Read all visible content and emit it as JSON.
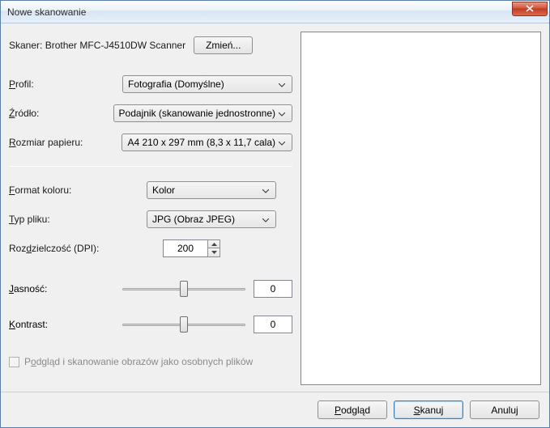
{
  "window": {
    "title": "Nowe skanowanie"
  },
  "scanner": {
    "label": "Skaner: Brother MFC-J4510DW Scanner",
    "change_btn": "Zmień..."
  },
  "profile": {
    "label": "Profil:",
    "value": "Fotografia (Domyślne)"
  },
  "source": {
    "label": "Źródło:",
    "value": "Podajnik (skanowanie jednostronne)"
  },
  "paper": {
    "label": "Rozmiar papieru:",
    "value": "A4 210 x 297 mm (8,3 x 11,7 cala)"
  },
  "color": {
    "label": "Format koloru:",
    "value": "Kolor"
  },
  "filetype": {
    "label": "Typ pliku:",
    "value": "JPG (Obraz JPEG)"
  },
  "dpi": {
    "label": "Rozdzielczość (DPI):",
    "value": "200"
  },
  "brightness": {
    "label": "Jasność:",
    "value": "0"
  },
  "contrast": {
    "label": "Kontrast:",
    "value": "0"
  },
  "checkbox": {
    "label": "Podgląd i skanowanie obrazów jako osobnych plików"
  },
  "footer": {
    "preview": "Podgląd",
    "scan": "Skanuj",
    "cancel": "Anuluj"
  }
}
